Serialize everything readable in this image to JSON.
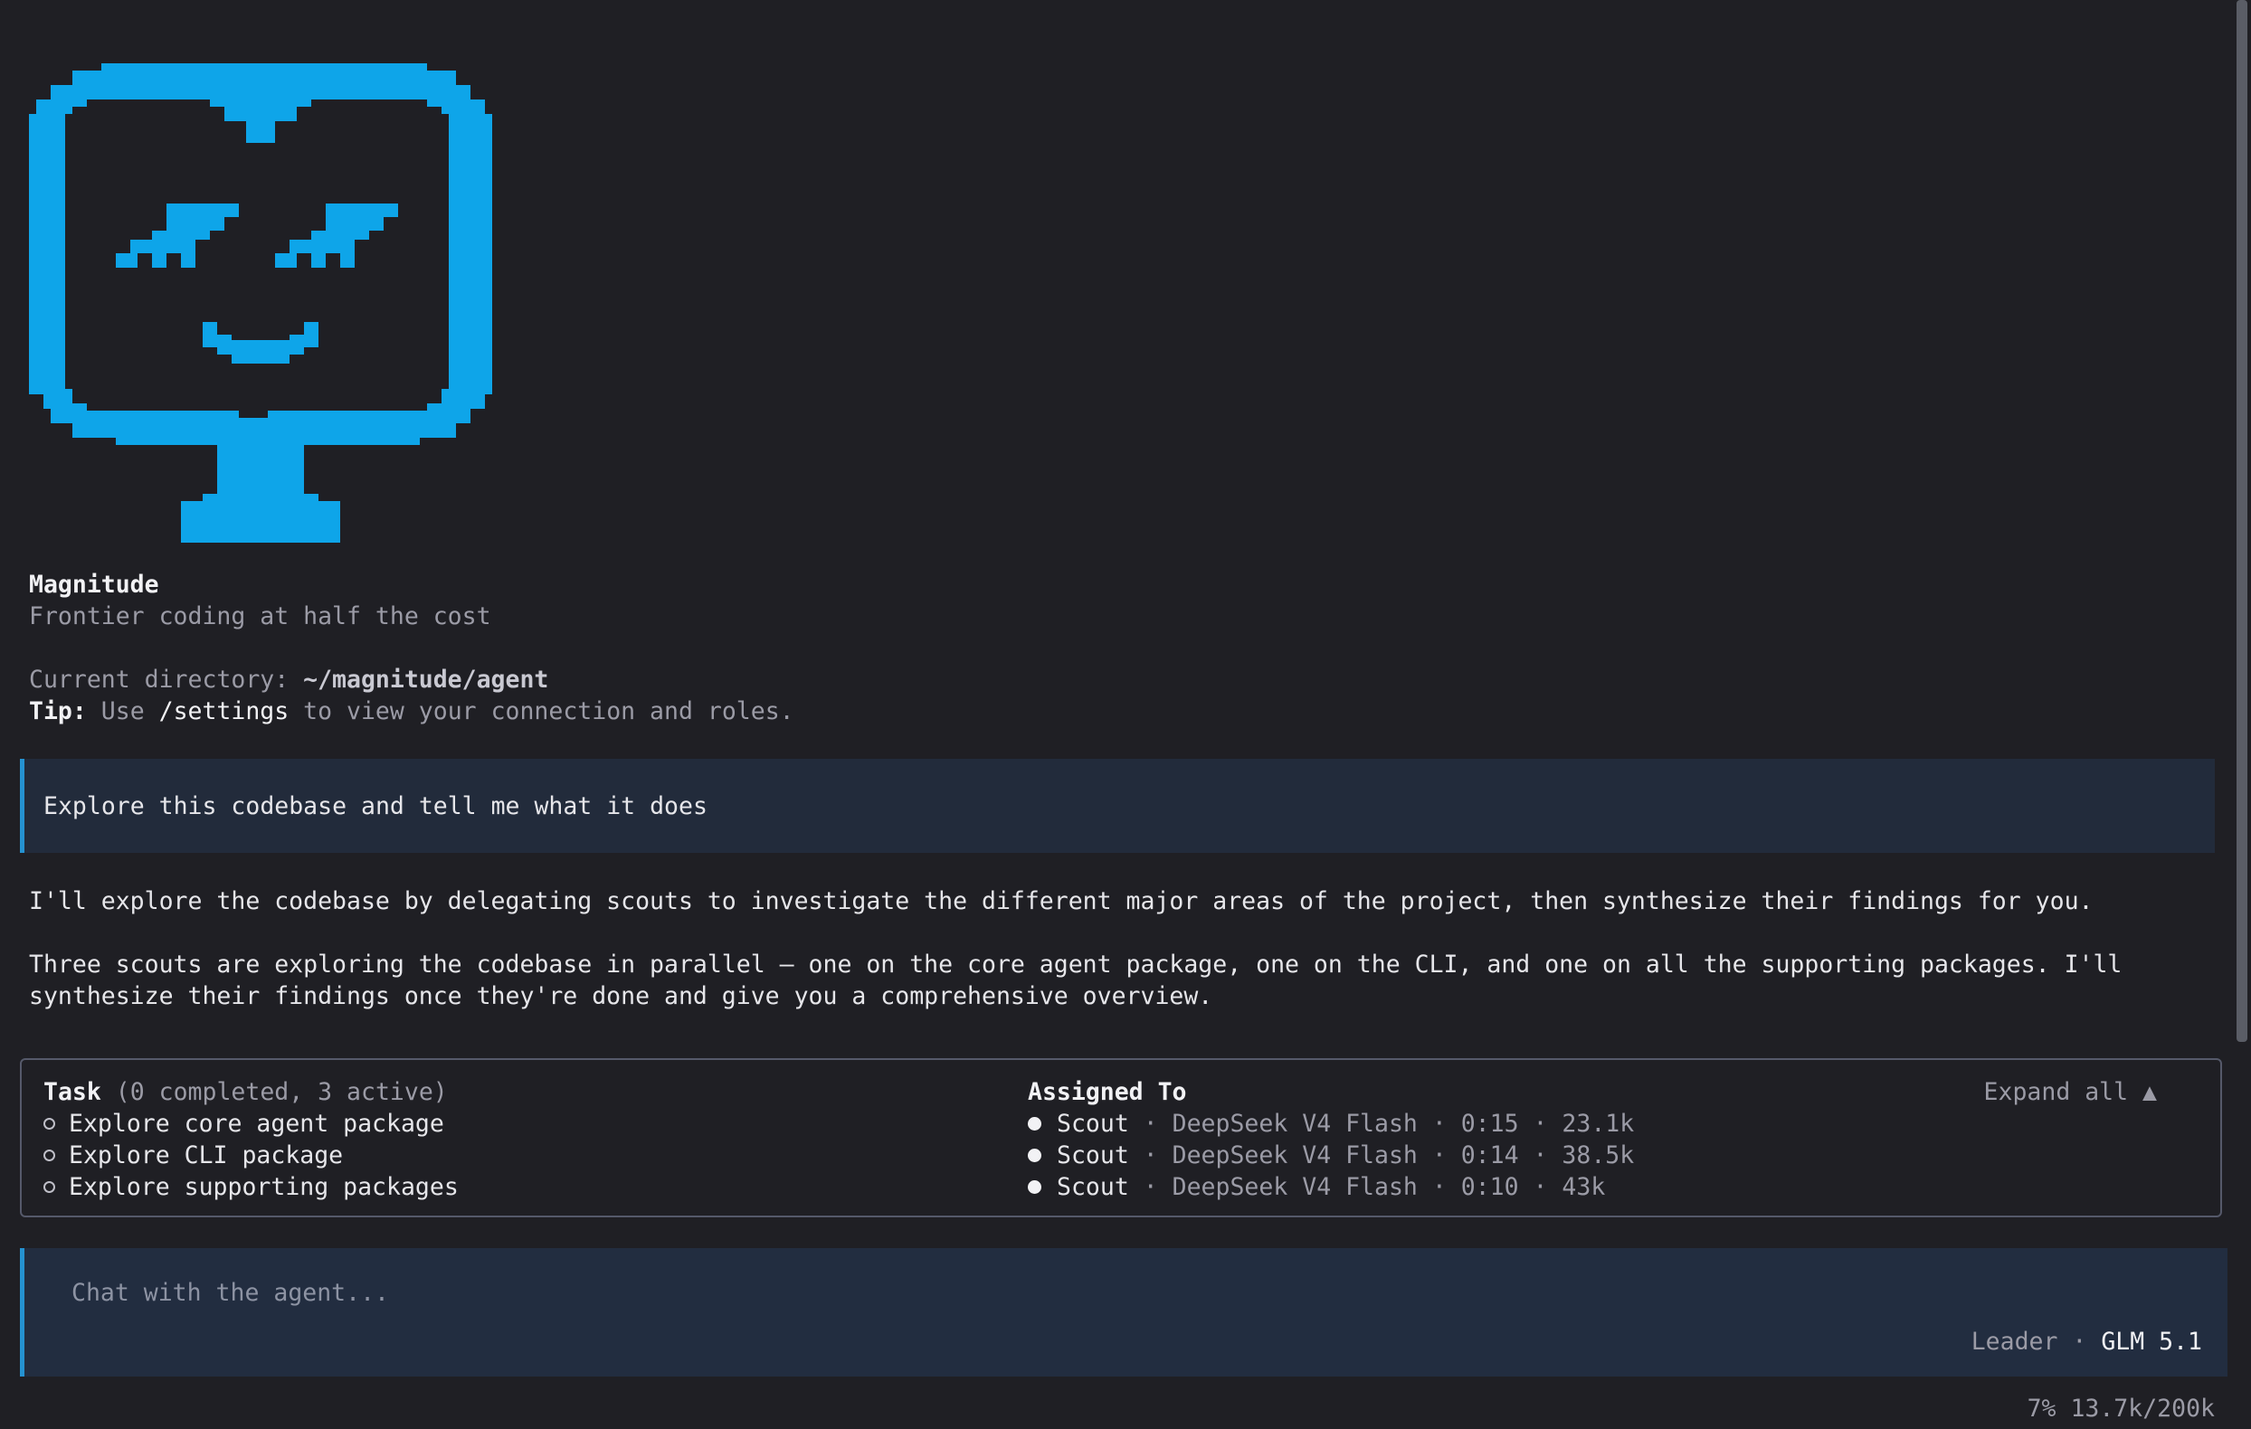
{
  "colors": {
    "background": "#1f1f24",
    "logo": "#0ea5e9",
    "accent_border": "#2592d1",
    "message_bg": "#222b3b",
    "panel_border": "#55596a"
  },
  "brand": {
    "name": "Magnitude",
    "tagline": "Frontier coding at half the cost"
  },
  "directory": {
    "label": "Current directory: ",
    "path": "~/magnitude/agent"
  },
  "tip": {
    "label": "Tip:",
    "pre": " Use ",
    "command": "/settings",
    "post": " to view your connection and roles."
  },
  "user_message": "Explore this codebase and tell me what it does",
  "assistant_messages": [
    "I'll explore the codebase by delegating scouts to investigate the different major areas of the project, then synthesize their findings for you.",
    "Three scouts are exploring the codebase in parallel — one on the core agent package, one on the CLI, and one on all the supporting packages. I'll synthesize their findings once they're done and give you a comprehensive overview."
  ],
  "tasks": {
    "header": "Task",
    "summary": " (0 completed, 3 active)",
    "assigned_header": "Assigned To",
    "expand_label": "Expand all ▲",
    "items": [
      {
        "title": "Explore core agent package",
        "agent": "Scout",
        "details": " · DeepSeek V4 Flash · 0:15 · 23.1k"
      },
      {
        "title": "Explore CLI package",
        "agent": "Scout",
        "details": " · DeepSeek V4 Flash · 0:14 · 38.5k"
      },
      {
        "title": "Explore supporting packages",
        "agent": "Scout",
        "details": " · DeepSeek V4 Flash · 0:10 · 43k"
      }
    ]
  },
  "chat": {
    "placeholder": "Chat with the agent...",
    "role": "Leader · ",
    "model": "GLM 5.1"
  },
  "status": {
    "usage": "7% 13.7k/200k"
  },
  "icons": {
    "logo": "monitor-face-logo",
    "pending": "empty-circle-icon",
    "active": "filled-dot-icon"
  }
}
